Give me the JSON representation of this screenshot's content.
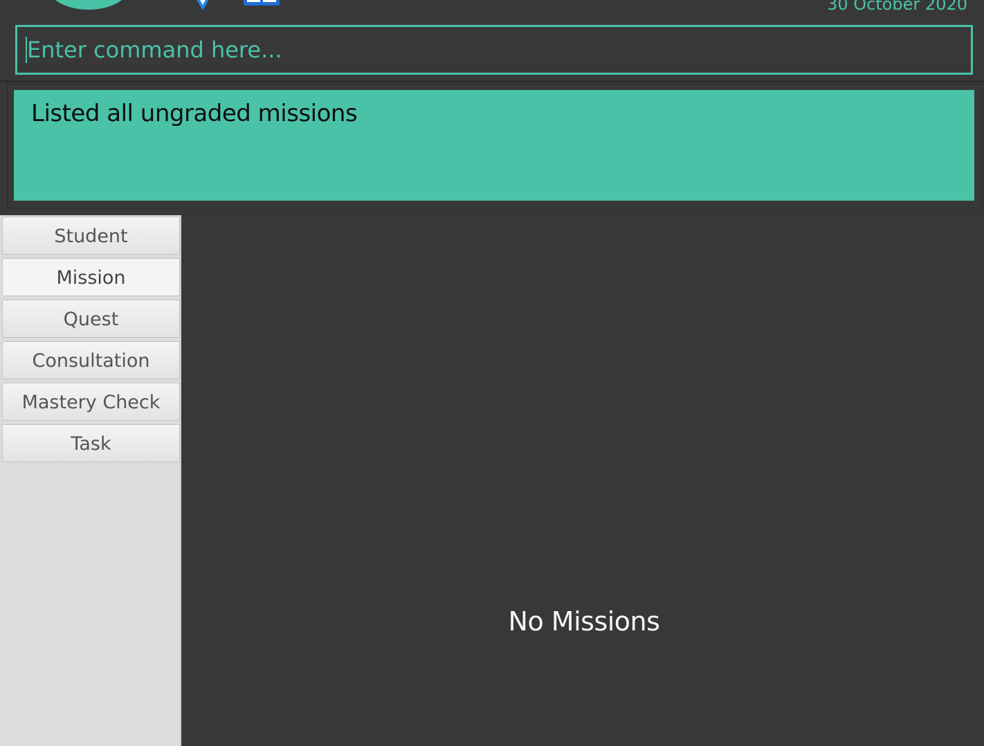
{
  "header": {
    "date": "30 October 2020",
    "icons": [
      "logo-circle",
      "location-pin-icon",
      "book-icon"
    ]
  },
  "command": {
    "placeholder": "Enter command here...",
    "value": ""
  },
  "result": {
    "message": "Listed all ungraded missions"
  },
  "sidebar": {
    "tabs": [
      {
        "label": "Student"
      },
      {
        "label": "Mission",
        "selected": true
      },
      {
        "label": "Quest"
      },
      {
        "label": "Consultation"
      },
      {
        "label": "Mastery Check"
      },
      {
        "label": "Task"
      }
    ]
  },
  "main": {
    "empty_message": "No Missions"
  },
  "colors": {
    "accent": "#4ac2a8",
    "background": "#383838",
    "sidebar": "#dcdcdc"
  }
}
